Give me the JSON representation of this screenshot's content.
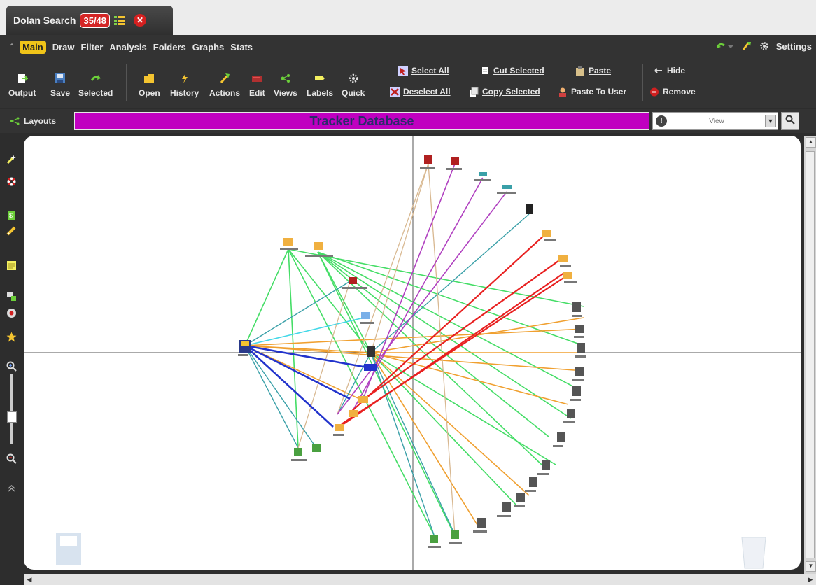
{
  "app": {
    "tab_title": "Dolan Search",
    "tab_badge": "35/48",
    "tab_icon": "list-icon",
    "close_icon": "close-icon"
  },
  "menu": {
    "items": [
      {
        "label": "Main",
        "active": true
      },
      {
        "label": "Draw",
        "active": false
      },
      {
        "label": "Filter",
        "active": false
      },
      {
        "label": "Analysis",
        "active": false
      },
      {
        "label": "Folders",
        "active": false
      },
      {
        "label": "Graphs",
        "active": false
      },
      {
        "label": "Stats",
        "active": false
      }
    ],
    "settings_label": "Settings"
  },
  "toolbar": {
    "buttons": [
      {
        "label": "Output",
        "icon": "output-icon"
      },
      {
        "label": "Save",
        "icon": "save-icon"
      },
      {
        "label": "Selected",
        "icon": "selected-arrow-icon"
      },
      {
        "label": "Open",
        "icon": "folder-icon"
      },
      {
        "label": "History",
        "icon": "history-icon"
      },
      {
        "label": "Actions",
        "icon": "actions-icon"
      },
      {
        "label": "Edit",
        "icon": "edit-icon"
      },
      {
        "label": "Views",
        "icon": "views-icon"
      },
      {
        "label": "Labels",
        "icon": "labels-icon"
      },
      {
        "label": "Quick",
        "icon": "gear-icon"
      }
    ],
    "select_all": "Select All",
    "deselect_all": "Deselect All",
    "cut_selected": "Cut Selected",
    "copy_selected": "Copy Selected",
    "paste": "Paste",
    "paste_to_user": "Paste To User",
    "hide": "Hide",
    "remove": "Remove"
  },
  "layouts_label": "Layouts",
  "database_title": "Tracker Database",
  "view_search": {
    "placeholder": "View"
  },
  "colors": {
    "accent": "#f0c419",
    "database_bar": "#c000c0",
    "edge_green": "#44dd66",
    "edge_red": "#e82020",
    "edge_orange": "#f0a030",
    "edge_teal": "#3aa0a8",
    "edge_blue": "#2233cc",
    "edge_purple": "#b040c0"
  }
}
